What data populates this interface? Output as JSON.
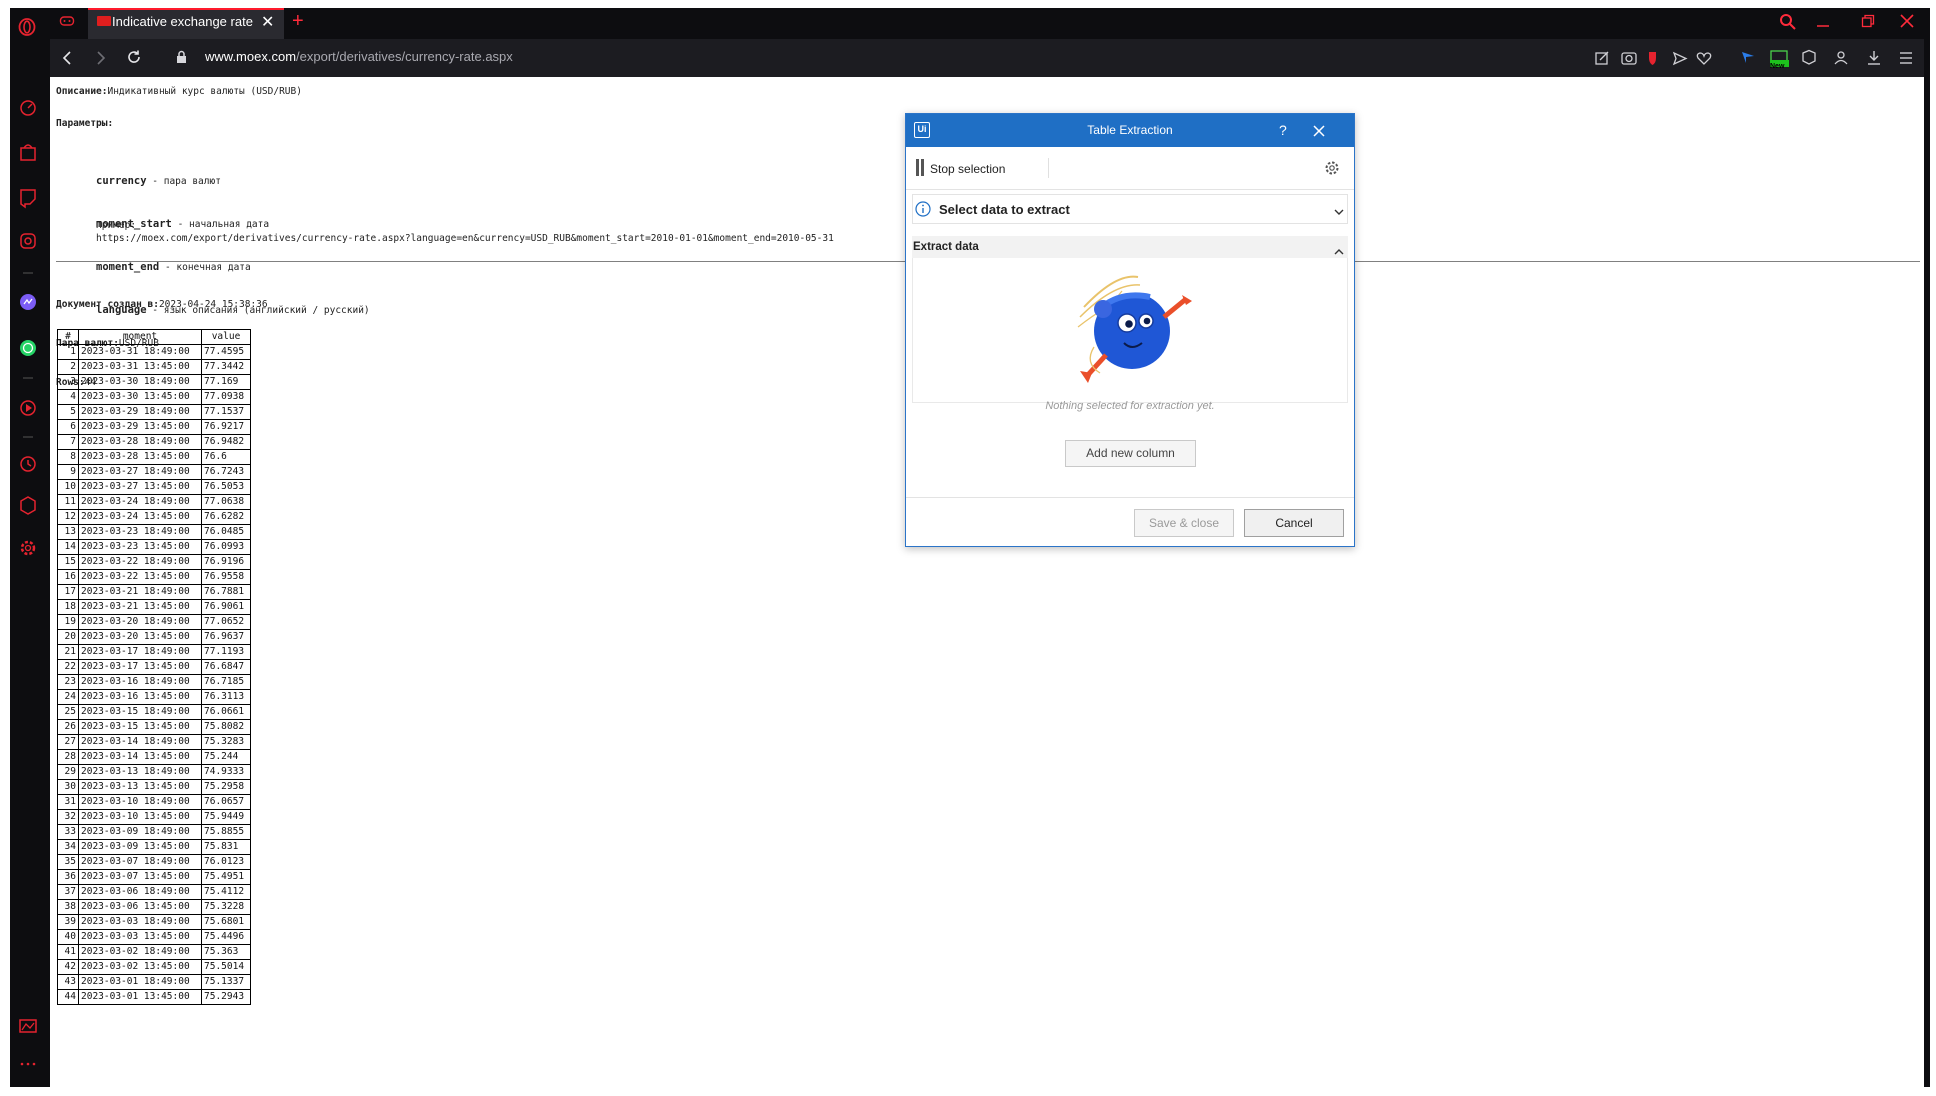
{
  "browser": {
    "tab_title": "Indicative exchange rate",
    "new_tab_symbol": "+",
    "url_domain": "www.moex.com",
    "url_path": "/export/derivatives/currency-rate.aspx",
    "badge_new": "New",
    "accent_color": "#ff1b2d",
    "sidebar_icons": [
      "speed-dial-icon",
      "shopping-bag-icon",
      "twitch-icon",
      "instagram-icon",
      "messenger-icon",
      "whatsapp-icon",
      "player-icon",
      "history-icon",
      "extensions-icon",
      "settings-icon",
      "pinboard-icon",
      "more-icon"
    ],
    "toolbar_icons": [
      "share-icon",
      "snapshot-icon",
      "shield-icon",
      "send-icon",
      "heart-icon",
      "flag-icon",
      "game-icon",
      "cube-icon",
      "account-icon",
      "download-icon",
      "menu-icon"
    ]
  },
  "page": {
    "desc_label": "Описание:",
    "desc_value": "Индикативный курс валюты (USD/RUB)",
    "params_label": "Параметры:",
    "params": [
      {
        "name": "currency",
        "desc": " - пара валют"
      },
      {
        "name": "moment_start",
        "desc": " - начальная дата"
      },
      {
        "name": "moment_end",
        "desc": " - конечная дата"
      },
      {
        "name": "language",
        "desc": " - язык описания (английский / русский)"
      }
    ],
    "example_label": "Пример:",
    "example_url": "https://moex.com/export/derivatives/currency-rate.aspx?language=en&currency=USD_RUB&moment_start=2010-01-01&moment_end=2010-05-31",
    "created_label": "Документ создан в:",
    "created_value": "2023-04-24 15:38:36",
    "pair_label": "Пара валют:",
    "pair_value": "USD/RUB",
    "rows_label": "Rows:",
    "rows_value": "44"
  },
  "table": {
    "headers": [
      "#",
      "moment",
      "value"
    ],
    "rows": [
      [
        "1",
        "2023-03-31 18:49:00",
        "77.4595"
      ],
      [
        "2",
        "2023-03-31 13:45:00",
        "77.3442"
      ],
      [
        "3",
        "2023-03-30 18:49:00",
        "77.169"
      ],
      [
        "4",
        "2023-03-30 13:45:00",
        "77.0938"
      ],
      [
        "5",
        "2023-03-29 18:49:00",
        "77.1537"
      ],
      [
        "6",
        "2023-03-29 13:45:00",
        "76.9217"
      ],
      [
        "7",
        "2023-03-28 18:49:00",
        "76.9482"
      ],
      [
        "8",
        "2023-03-28 13:45:00",
        "76.6"
      ],
      [
        "9",
        "2023-03-27 18:49:00",
        "76.7243"
      ],
      [
        "10",
        "2023-03-27 13:45:00",
        "76.5053"
      ],
      [
        "11",
        "2023-03-24 18:49:00",
        "77.0638"
      ],
      [
        "12",
        "2023-03-24 13:45:00",
        "76.6282"
      ],
      [
        "13",
        "2023-03-23 18:49:00",
        "76.0485"
      ],
      [
        "14",
        "2023-03-23 13:45:00",
        "76.0993"
      ],
      [
        "15",
        "2023-03-22 18:49:00",
        "76.9196"
      ],
      [
        "16",
        "2023-03-22 13:45:00",
        "76.9558"
      ],
      [
        "17",
        "2023-03-21 18:49:00",
        "76.7881"
      ],
      [
        "18",
        "2023-03-21 13:45:00",
        "76.9061"
      ],
      [
        "19",
        "2023-03-20 18:49:00",
        "77.0652"
      ],
      [
        "20",
        "2023-03-20 13:45:00",
        "76.9637"
      ],
      [
        "21",
        "2023-03-17 18:49:00",
        "77.1193"
      ],
      [
        "22",
        "2023-03-17 13:45:00",
        "76.6847"
      ],
      [
        "23",
        "2023-03-16 18:49:00",
        "76.7185"
      ],
      [
        "24",
        "2023-03-16 13:45:00",
        "76.3113"
      ],
      [
        "25",
        "2023-03-15 18:49:00",
        "76.0661"
      ],
      [
        "26",
        "2023-03-15 13:45:00",
        "75.8082"
      ],
      [
        "27",
        "2023-03-14 18:49:00",
        "75.3283"
      ],
      [
        "28",
        "2023-03-14 13:45:00",
        "75.244"
      ],
      [
        "29",
        "2023-03-13 18:49:00",
        "74.9333"
      ],
      [
        "30",
        "2023-03-13 13:45:00",
        "75.2958"
      ],
      [
        "31",
        "2023-03-10 18:49:00",
        "76.0657"
      ],
      [
        "32",
        "2023-03-10 13:45:00",
        "75.9449"
      ],
      [
        "33",
        "2023-03-09 18:49:00",
        "75.8855"
      ],
      [
        "34",
        "2023-03-09 13:45:00",
        "75.831"
      ],
      [
        "35",
        "2023-03-07 18:49:00",
        "76.0123"
      ],
      [
        "36",
        "2023-03-07 13:45:00",
        "75.4951"
      ],
      [
        "37",
        "2023-03-06 18:49:00",
        "75.4112"
      ],
      [
        "38",
        "2023-03-06 13:45:00",
        "75.3228"
      ],
      [
        "39",
        "2023-03-03 18:49:00",
        "75.6801"
      ],
      [
        "40",
        "2023-03-03 13:45:00",
        "75.4496"
      ],
      [
        "41",
        "2023-03-02 18:49:00",
        "75.363"
      ],
      [
        "42",
        "2023-03-02 13:45:00",
        "75.5014"
      ],
      [
        "43",
        "2023-03-01 18:49:00",
        "75.1337"
      ],
      [
        "44",
        "2023-03-01 13:45:00",
        "75.2943"
      ]
    ]
  },
  "dialog": {
    "logo": "Ui",
    "title": "Table Extraction",
    "help": "?",
    "stop_selection": "Stop selection",
    "select_data": "Select data to extract",
    "extract_data": "Extract data",
    "empty_message": "Nothing selected for extraction yet.",
    "add_column": "Add new column",
    "save_close": "Save & close",
    "cancel": "Cancel",
    "title_color": "#1f6fc5"
  }
}
